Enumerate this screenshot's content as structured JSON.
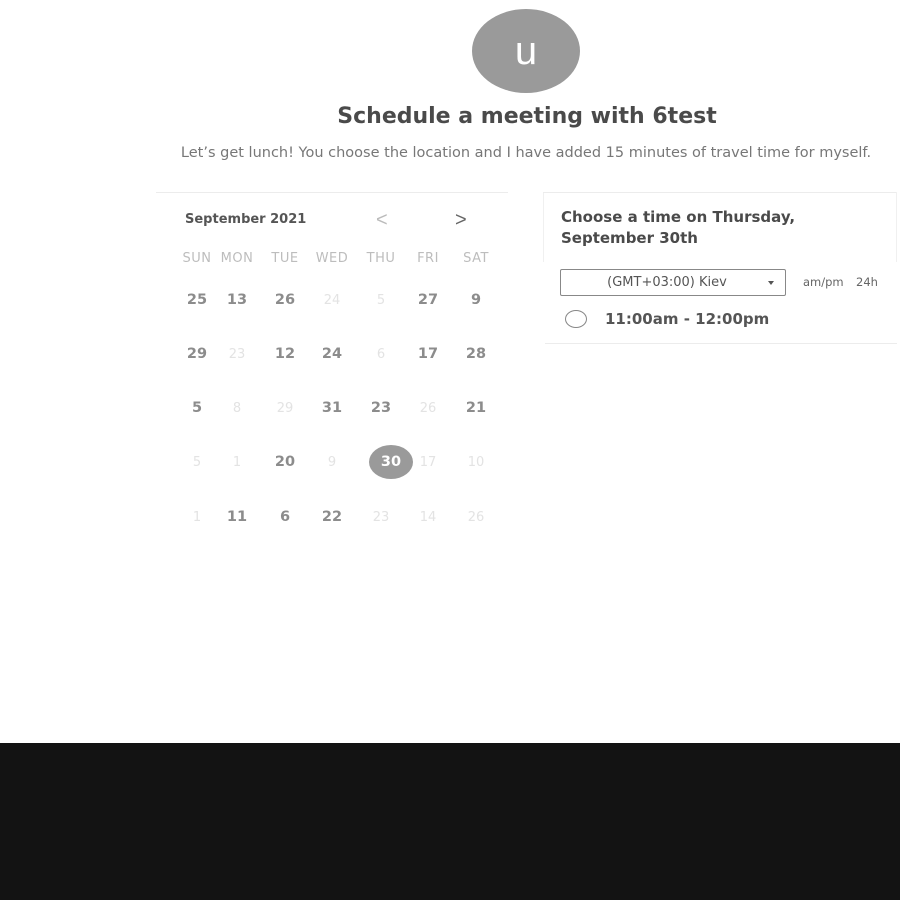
{
  "profile": {
    "avatar_initial": "u"
  },
  "header": {
    "title": "Schedule a meeting with 6test",
    "description": "Let’s get lunch! You choose the location and I have added 15 minutes of travel time for myself."
  },
  "calendar": {
    "month_label": "September 2021",
    "prev_label": "<",
    "next_label": ">",
    "weekdays": [
      "SUN",
      "MON",
      "TUE",
      "WED",
      "THU",
      "FRI",
      "SAT"
    ],
    "weeks": [
      [
        {
          "d": "25",
          "s": "available"
        },
        {
          "d": "13",
          "s": "available"
        },
        {
          "d": "26",
          "s": "available"
        },
        {
          "d": "24",
          "s": "disabled"
        },
        {
          "d": "5",
          "s": "disabled"
        },
        {
          "d": "27",
          "s": "available"
        },
        {
          "d": "9",
          "s": "available"
        }
      ],
      [
        {
          "d": "29",
          "s": "available"
        },
        {
          "d": "23",
          "s": "disabled"
        },
        {
          "d": "12",
          "s": "available"
        },
        {
          "d": "24",
          "s": "available"
        },
        {
          "d": "6",
          "s": "disabled"
        },
        {
          "d": "17",
          "s": "available"
        },
        {
          "d": "28",
          "s": "available"
        }
      ],
      [
        {
          "d": "5",
          "s": "available"
        },
        {
          "d": "8",
          "s": "disabled"
        },
        {
          "d": "29",
          "s": "disabled"
        },
        {
          "d": "31",
          "s": "available"
        },
        {
          "d": "23",
          "s": "available"
        },
        {
          "d": "26",
          "s": "disabled"
        },
        {
          "d": "21",
          "s": "available"
        }
      ],
      [
        {
          "d": "5",
          "s": "disabled"
        },
        {
          "d": "1",
          "s": "disabled"
        },
        {
          "d": "20",
          "s": "available"
        },
        {
          "d": "9",
          "s": "disabled"
        },
        {
          "d": "30",
          "s": "selected"
        },
        {
          "d": "17",
          "s": "disabled"
        },
        {
          "d": "10",
          "s": "disabled"
        }
      ],
      [
        {
          "d": "1",
          "s": "disabled"
        },
        {
          "d": "11",
          "s": "available"
        },
        {
          "d": "6",
          "s": "available"
        },
        {
          "d": "22",
          "s": "available"
        },
        {
          "d": "23",
          "s": "disabled"
        },
        {
          "d": "14",
          "s": "disabled"
        },
        {
          "d": "26",
          "s": "disabled"
        }
      ]
    ]
  },
  "time_picker": {
    "heading": "Choose a time on Thursday, September 30th",
    "timezone": "(GMT+03:00) Kiev",
    "format_ampm": "am/pm",
    "format_24h": "24h",
    "slots": [
      {
        "label": "11:00am - 12:00pm"
      }
    ]
  },
  "colors": {
    "selected_day": "#9a9a9a",
    "footer": "#131313"
  }
}
